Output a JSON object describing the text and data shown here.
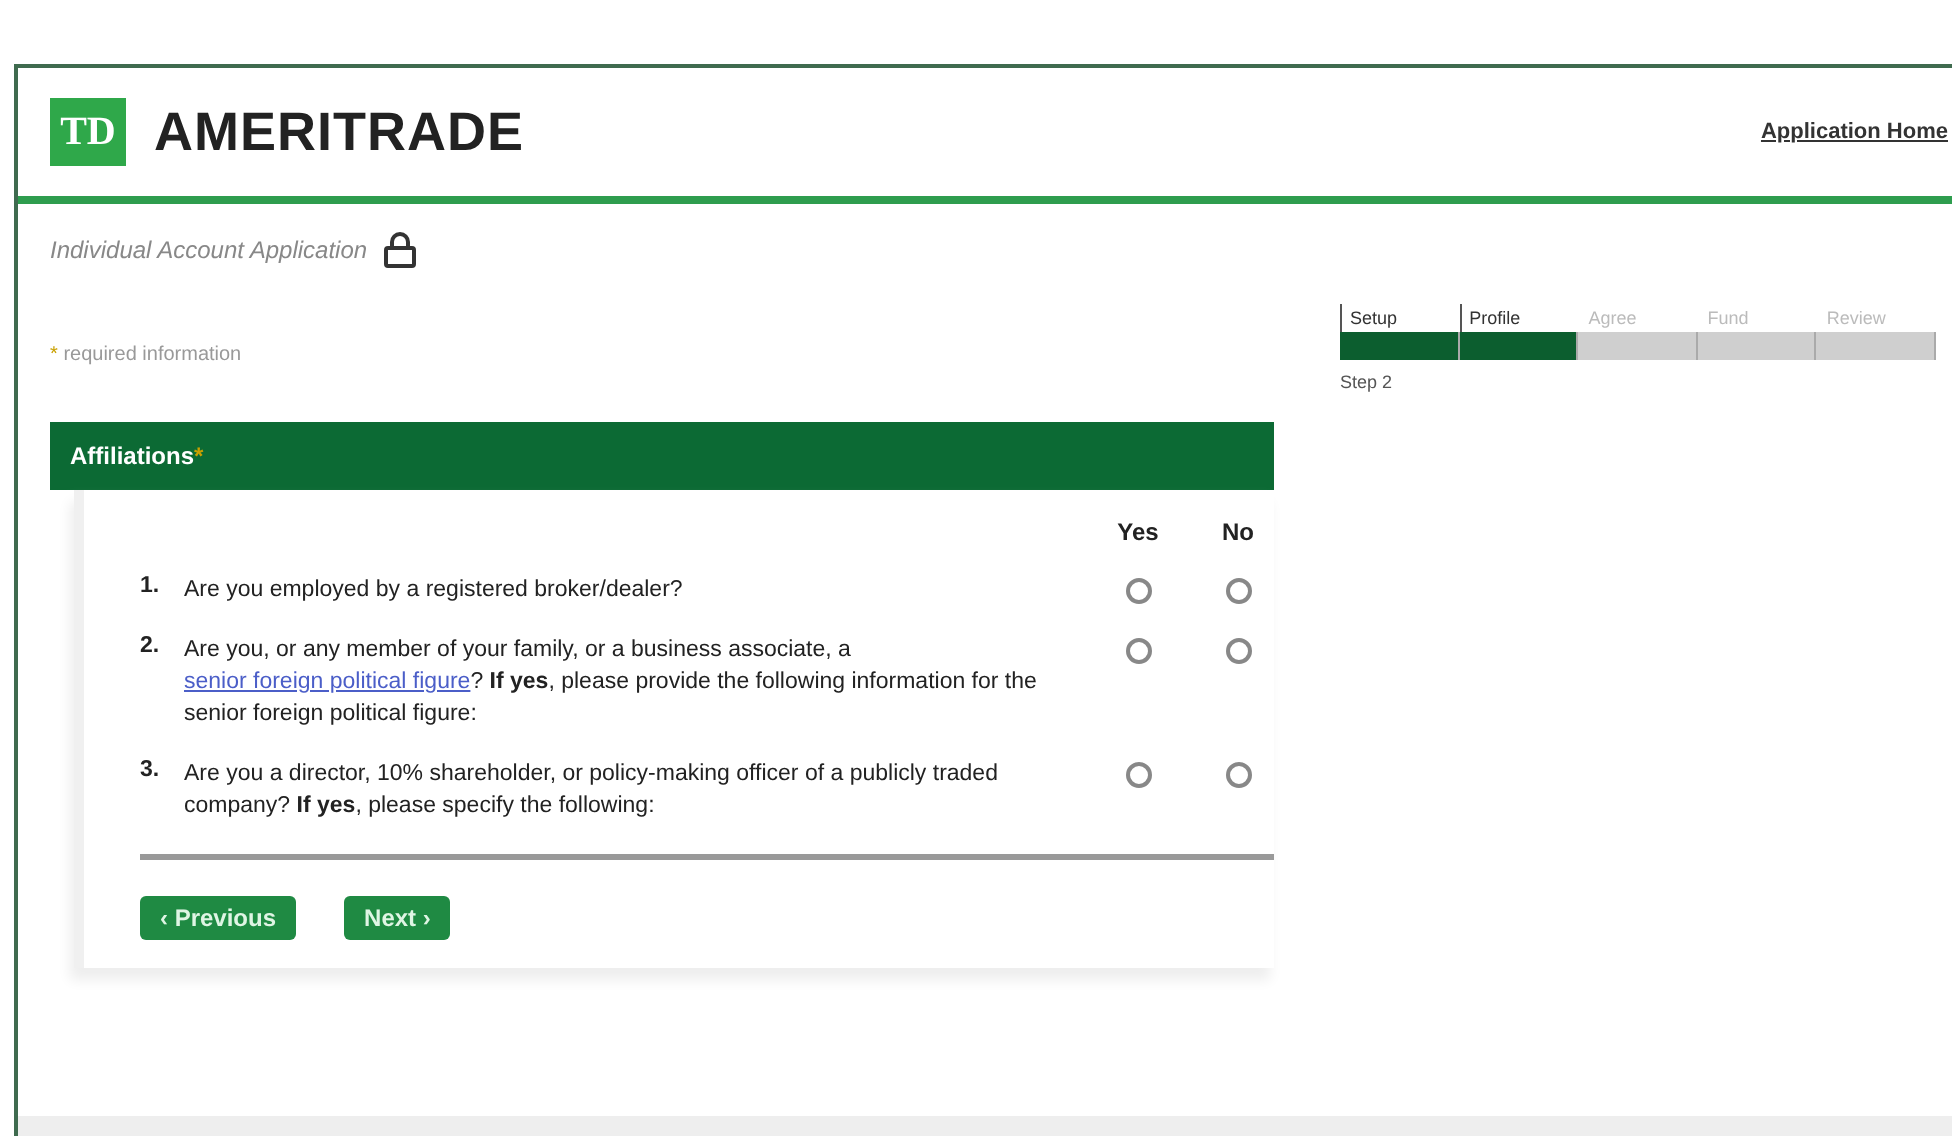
{
  "header": {
    "logo_mark": "TD",
    "logo_text": "AMERITRADE",
    "home_link": "Application Home"
  },
  "page_title": "Individual Account Application",
  "required_note": {
    "mark": "*",
    "text": "required information"
  },
  "section": {
    "title": "Affiliations",
    "mark": "*"
  },
  "columns": [
    "Yes",
    "No"
  ],
  "questions": [
    {
      "number": "1.",
      "parts": [
        {
          "kind": "text",
          "text": "Are you employed by a registered broker/dealer?"
        }
      ],
      "choices": [
        {
          "selected": false
        },
        {
          "selected": false
        }
      ]
    },
    {
      "number": "2.",
      "parts": [
        {
          "kind": "text",
          "text": "Are you, or any member of your family, or a business associate, a "
        },
        {
          "kind": "link",
          "text": "senior foreign political figure"
        },
        {
          "kind": "text",
          "text": "? **If yes**, please provide the following information for the senior foreign political figure:"
        }
      ],
      "choices": [
        {
          "selected": false
        },
        {
          "selected": false
        }
      ]
    },
    {
      "number": "3.",
      "parts": [
        {
          "kind": "text",
          "text": "Are you a director, 10% shareholder, or policy-making officer of a publicly traded company? **If yes**, please specify the following:"
        }
      ],
      "choices": [
        {
          "selected": false
        },
        {
          "selected": false
        }
      ]
    }
  ],
  "buttons": [
    {
      "label": "‹ Previous"
    },
    {
      "label": "Next ›"
    }
  ],
  "steps": [
    {
      "label": "Setup",
      "done": true
    },
    {
      "label": "Profile",
      "done": true
    },
    {
      "label": "Agree",
      "done": false
    },
    {
      "label": "Fund",
      "done": false
    },
    {
      "label": "Review",
      "done": false
    }
  ],
  "step_caption": "Step 2"
}
